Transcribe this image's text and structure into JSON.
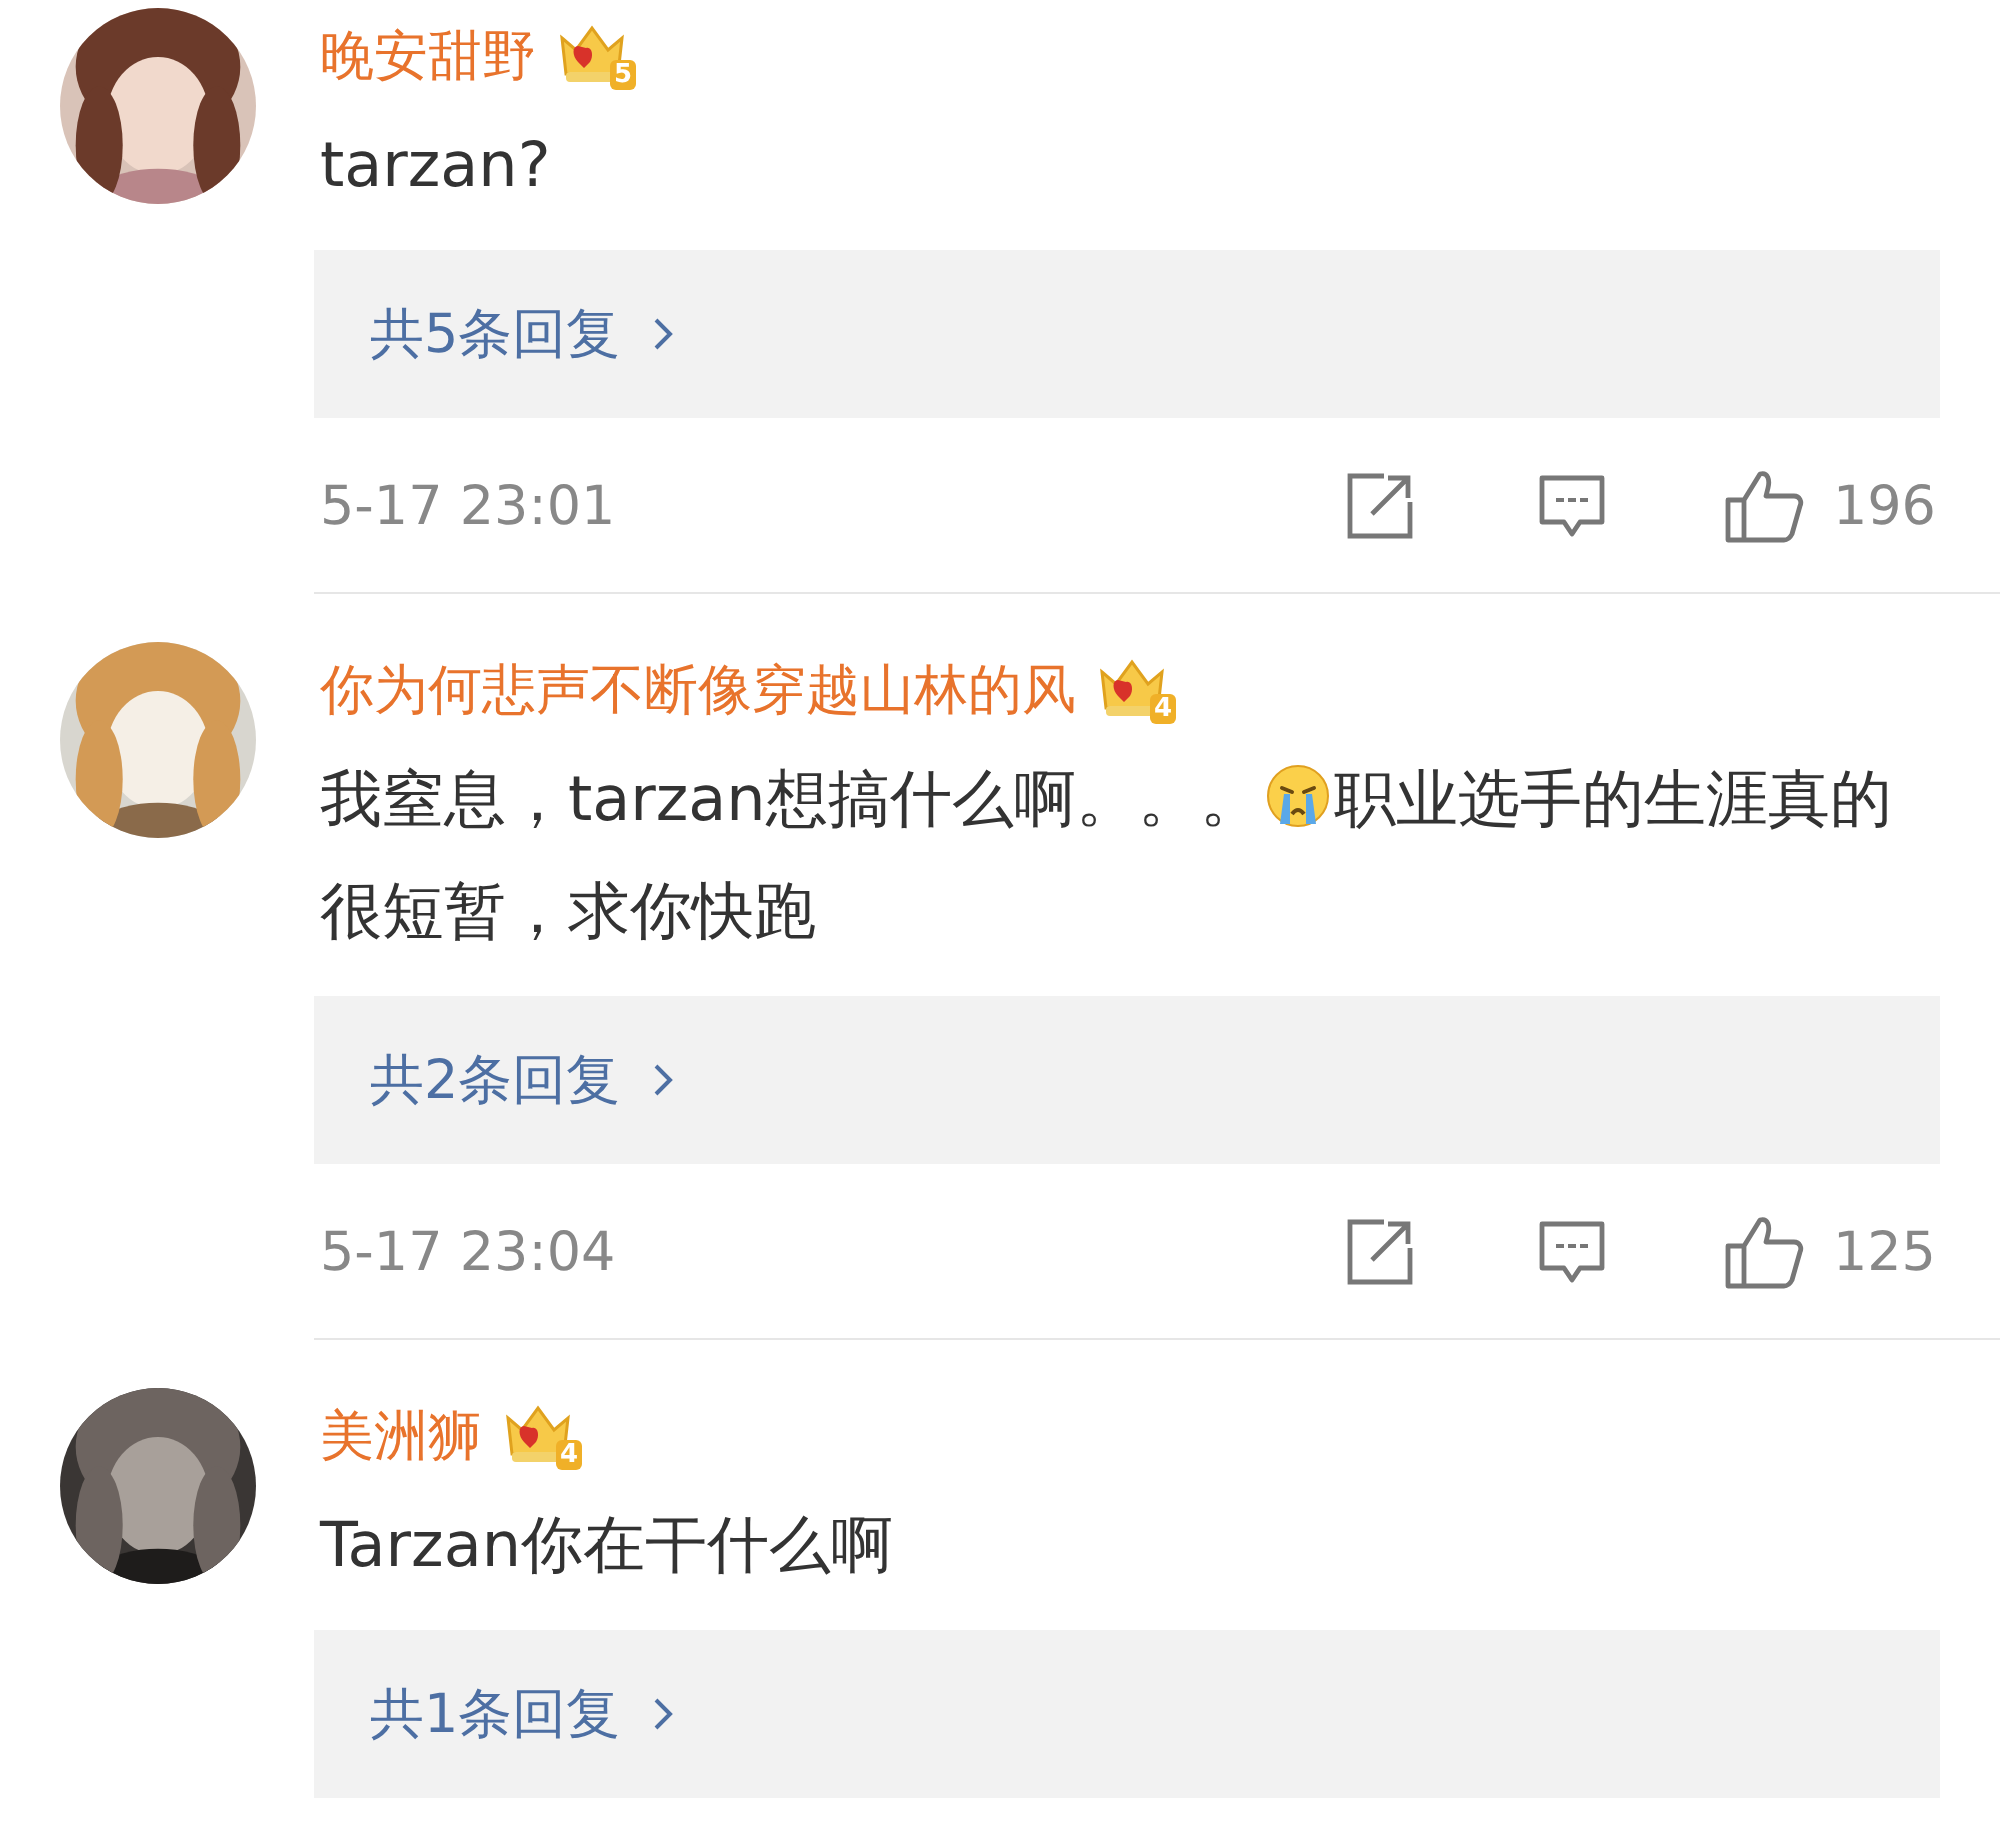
{
  "comments": [
    {
      "author": "晚安甜野",
      "badge_level": "5",
      "text": [
        {
          "kind": "text",
          "value": "tarzan?"
        }
      ],
      "replies": "共5条回复",
      "time": "5-17 23:01",
      "likes": "196"
    },
    {
      "author": "你为何悲声不断像穿越山林的风",
      "badge_level": "4",
      "text": [
        {
          "kind": "text",
          "value": "我窒息，tarzan想搞什么啊。。。"
        },
        {
          "kind": "emoji"
        },
        {
          "kind": "text",
          "value": "职业选手的生涯真的很短暂，求你快跑"
        }
      ],
      "replies": "共2条回复",
      "time": "5-17 23:04",
      "likes": "125"
    },
    {
      "author": "美洲狮",
      "badge_level": "4",
      "text": [
        {
          "kind": "text",
          "value": "Tarzan你在干什么啊"
        }
      ],
      "replies": "共1条回复"
    }
  ]
}
